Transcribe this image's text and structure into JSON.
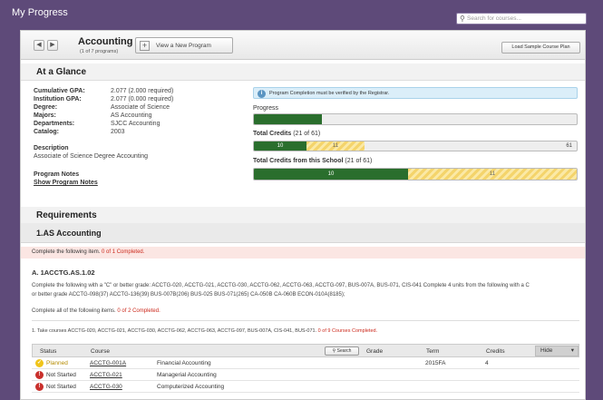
{
  "app": {
    "title": "My Progress",
    "search_placeholder": "Search for courses..."
  },
  "program": {
    "name": "Accounting",
    "sub": "(1 of 7 programs)",
    "view_new": "View a New Program",
    "load_sample": "Load Sample Course Plan"
  },
  "glance": {
    "header": "At a Glance",
    "cumulative_gpa_label": "Cumulative GPA:",
    "cumulative_gpa": "2.077 (2.000 required)",
    "institution_gpa_label": "Institution GPA:",
    "institution_gpa": "2.077 (0.000 required)",
    "degree_label": "Degree:",
    "degree": "Associate of Science",
    "majors_label": "Majors:",
    "majors": "AS Accounting",
    "departments_label": "Departments:",
    "departments": "SJCC Accounting",
    "catalog_label": "Catalog:",
    "catalog": "2003",
    "description_label": "Description",
    "description": "Associate of Science Degree Accounting",
    "notes_label": "Program Notes",
    "notes_link": "Show Program Notes",
    "info_message": "Program Completion must be verified by the Registrar.",
    "progress_label": "Progress",
    "progress_fraction": 0.21,
    "total_credits_label": "Total Credits",
    "total_credits_count": "(21 of 61)",
    "total_credits_done": "10",
    "total_credits_planned": "11",
    "total_credits_total": "61",
    "total_credits_done_value": 10,
    "total_credits_planned_value": 11,
    "total_credits_total_value": 61,
    "school_credits_label": "Total Credits from this School",
    "school_credits_count": "(21 of 61)",
    "school_credits_done": "10",
    "school_credits_planned": "11",
    "school_credits_done_value": 10,
    "school_credits_planned_value": 11,
    "school_credits_total_value": 21
  },
  "requirements": {
    "header": "Requirements",
    "group_title": "1.AS Accounting",
    "group_instruction": "Complete the following item.",
    "group_status": "0 of 1 Completed.",
    "item_title": "A. 1ACCTG.AS.1.02",
    "item_text_1": "Complete the following with a \"C\" or better grade: ACCTG-020, ACCTG-021, ACCTG-030, ACCTG-062, ACCTG-063, ACCTG-097, BUS-007A, BUS-071, CIS-041 Complete 4 units from the following with a C",
    "item_text_2": "or better grade ACCTG-098(37) ACCTG-136(39) BUS-007B(206) BUS-025 BUS-071(265) CA-050B CA-060B ECON-010A(8185);",
    "all_items_text": "Complete all of the following items.",
    "all_items_status": "0 of 2 Completed.",
    "take_text": "1. Take courses ACCTG-020, ACCTG-021, ACCTG-030, ACCTG-062, ACCTG-063, ACCTG-097, BUS-007A, CIS-041, BUS-071.",
    "take_status": "0 of 9 Courses Completed."
  },
  "table": {
    "headers": {
      "status": "Status",
      "course": "Course",
      "search": "Search",
      "grade": "Grade",
      "term": "Term",
      "credits": "Credits",
      "hide": "Hide"
    },
    "rows": [
      {
        "status": "Planned",
        "code": "ACCTG-001A",
        "title": "Financial Accounting",
        "grade": "",
        "term": "2015FA",
        "credits": "4"
      },
      {
        "status": "Not Started",
        "code": "ACCTG-021",
        "title": "Managerial Accounting",
        "grade": "",
        "term": "",
        "credits": ""
      },
      {
        "status": "Not Started",
        "code": "ACCTG-030",
        "title": "Computerized Accounting",
        "grade": "",
        "term": "",
        "credits": ""
      }
    ]
  },
  "colors": {
    "header_purple": "#5e4a79",
    "complete_green": "#2a6e2d",
    "planned_yellow": "#f4d46b",
    "status_red": "#cc2a1d"
  }
}
